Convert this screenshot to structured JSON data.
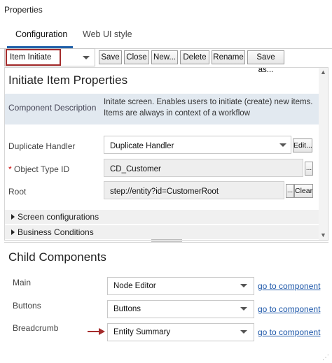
{
  "panel_title": "Properties",
  "tabs": [
    {
      "label": "Configuration",
      "active": true
    },
    {
      "label": "Web UI style",
      "active": false
    }
  ],
  "toolbar": {
    "screen_select_value": "Item Initiate",
    "buttons": [
      "Save",
      "Close",
      "New...",
      "Delete",
      "Rename",
      "Save as..."
    ]
  },
  "properties": {
    "title": "Initiate Item Properties",
    "component_description_label": "Component Description",
    "component_description_text": "Initate screen. Enables users to initiate (create) new items. Items are always in context of a workflow",
    "duplicate_handler_label": "Duplicate Handler",
    "duplicate_handler_value": "Duplicate Handler",
    "duplicate_handler_edit": "Edit...",
    "required_marker": "*",
    "object_type_label": "Object Type ID",
    "object_type_value": "CD_Customer",
    "object_type_browse": "...",
    "root_label": "Root",
    "root_value": "step://entity?id=CustomerRoot",
    "root_browse": "...",
    "root_clear": "Clear",
    "sections": [
      "Screen configurations",
      "Business Conditions"
    ]
  },
  "child_components": {
    "title": "Child Components",
    "link_text": "go to component",
    "rows": [
      {
        "label": "Main",
        "value": "Node Editor"
      },
      {
        "label": "Buttons",
        "value": "Buttons"
      },
      {
        "label": "Breadcrumb",
        "value": "Entity Summary"
      }
    ]
  },
  "colors": {
    "highlight": "#a42b2b",
    "tab_accent": "#1f5fa8",
    "link": "#1a55a8",
    "description_band": "#e2e9f0"
  }
}
